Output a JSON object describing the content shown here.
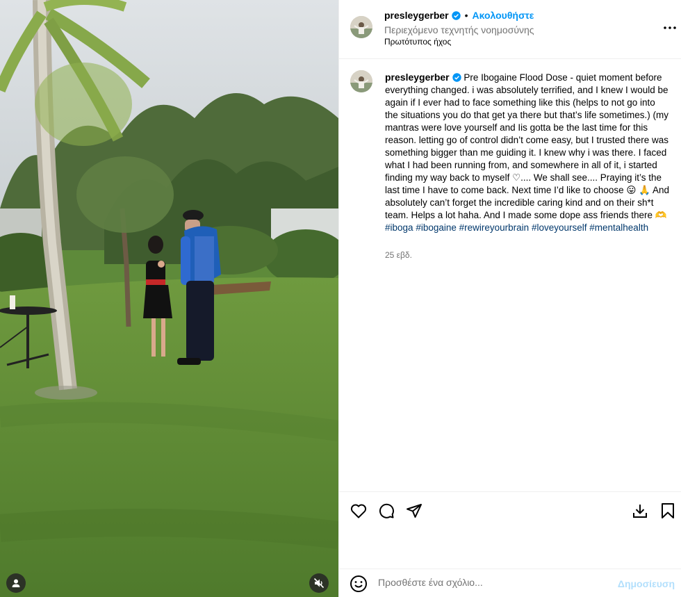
{
  "header": {
    "username": "presleygerber",
    "separator": "•",
    "follow_label": "Ακολουθήστε",
    "ai_label": "Περιεχόμενο τεχνητής νοημοσύνης",
    "audio_label": "Πρωτότυπος ήχος"
  },
  "caption": {
    "username": "presleygerber",
    "text": " Pre Ibogaine Flood Dose - quiet moment before everything changed. i was absolutely terrified, and I knew I would be again if I ever had to face something like this (helps to not go into the situations you do that get ya there but that’s life sometimes.) (my mantras were love yourself and Iis gotta be the last time for this reason. letting go of control didn’t come easy, but I trusted there was something bigger than me guiding it. I knew why i was there. I faced what I had been running from, and somewhere in all of it, i started finding my way back to myself ♡.... We shall see.... Praying it’s the last time I have to come back. Next time I’d like to choose 😛 🙏 And absolutely can’t forget the incredible caring kind and on their sh*t team. Helps a lot haha. And I made some dope ass friends there 🫶 ",
    "hashtags": [
      "#iboga",
      "#ibogaine",
      "#rewireyourbrain",
      "#loveyourself",
      "#mentalhealth"
    ],
    "age": "25 εβδ."
  },
  "comment": {
    "placeholder": "Προσθέστε ένα σχόλιο...",
    "post_label": "Δημοσίευση"
  },
  "icons": {
    "verified": "verified-badge-icon",
    "more": "more-options-icon",
    "like": "heart-icon",
    "comment": "comment-icon",
    "share": "share-icon",
    "download": "download-icon",
    "save": "bookmark-icon",
    "emoji": "emoji-icon",
    "tags": "user-tags-icon",
    "mute": "muted-speaker-icon"
  },
  "colors": {
    "accent": "#0095f6",
    "hashtag": "#00376b",
    "secondary_text": "#737373",
    "post_disabled": "#b2dffc"
  }
}
